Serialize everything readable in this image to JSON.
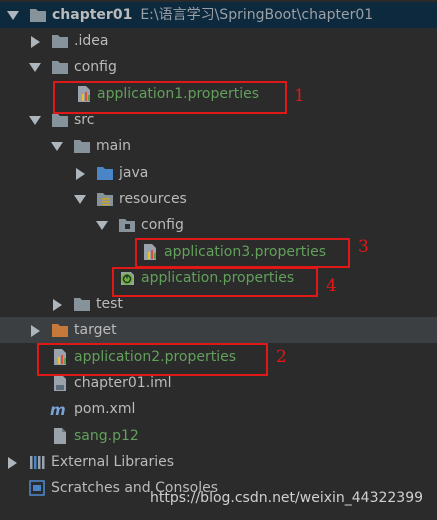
{
  "project": {
    "name": "chapter01",
    "path": "E:\\语言学习\\SpringBoot\\chapter01"
  },
  "tree": {
    "idea": ".idea",
    "config": "config",
    "app1": "application1.properties",
    "src": "src",
    "main": "main",
    "java": "java",
    "resources": "resources",
    "res_config": "config",
    "app3": "application3.properties",
    "app": "application.properties",
    "test": "test",
    "target": "target",
    "app2": "application2.properties",
    "iml": "chapter01.iml",
    "pom": "pom.xml",
    "p12": "sang.p12",
    "ext": "External Libraries",
    "scratches": "Scratches and Consoles"
  },
  "annotations": [
    "1",
    "2",
    "3",
    "4"
  ],
  "watermark": "https://blog.csdn.net/weixin_44322399",
  "colors": {
    "selection": "#0d293e",
    "highlight_box": "#e01818",
    "props_text": "#62a05c",
    "folder": "#87939a",
    "source_folder": "#4a86c7"
  }
}
